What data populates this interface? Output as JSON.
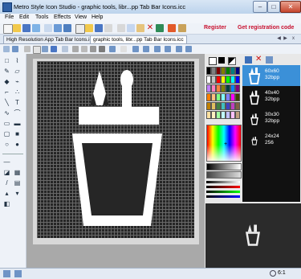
{
  "window": {
    "title": "Metro Style Icon Studio - graphic tools, libr...pp Tab Bar Icons.icc",
    "minimize": "–",
    "maximize": "□",
    "close": "✕"
  },
  "menu": [
    "File",
    "Edit",
    "Tools",
    "Effects",
    "View",
    "Help"
  ],
  "toolbar": {
    "register": "Register",
    "get_code": "Get registration code"
  },
  "tabs": {
    "tab1": "High Resolution App Tab Bar Icons.icc",
    "tab2": "graphic tools, libr...pp Tab Bar Icons.icc",
    "close": "x"
  },
  "palette_colors": [
    "#000000",
    "#7f7f7f",
    "#7f0000",
    "#7f7f00",
    "#007f00",
    "#007f7f",
    "#00007f",
    "#ffffff",
    "#c3c3c3",
    "#ff0000",
    "#ffff00",
    "#00ff00",
    "#00ffff",
    "#0000ff",
    "#c080ff",
    "#ff80c0",
    "#ff8040",
    "#808000",
    "#004040",
    "#0080ff",
    "#800080",
    "#ff8000",
    "#ffc080",
    "#80ff80",
    "#80ffff",
    "#8080ff",
    "#ff00ff",
    "#404000",
    "#c08000",
    "#e0c060",
    "#408040",
    "#40c0c0",
    "#4040c0",
    "#c040c0",
    "#806040",
    "#ffe0a0",
    "#fff0c0",
    "#a0ffa0",
    "#c0ffff",
    "#c0c0ff",
    "#ffc0ff",
    "#c0a080"
  ],
  "icon_sizes": [
    {
      "label": "60x60\n32bpp",
      "selected": true
    },
    {
      "label": "40x40\n32bpp",
      "selected": false
    },
    {
      "label": "30x30\n32bpp",
      "selected": false
    },
    {
      "label": "24x24\n256",
      "selected": false
    }
  ],
  "status": {
    "zoom": "6:1"
  },
  "colors": {
    "accent": "#3b90d8",
    "register_text": "#c8102e"
  }
}
